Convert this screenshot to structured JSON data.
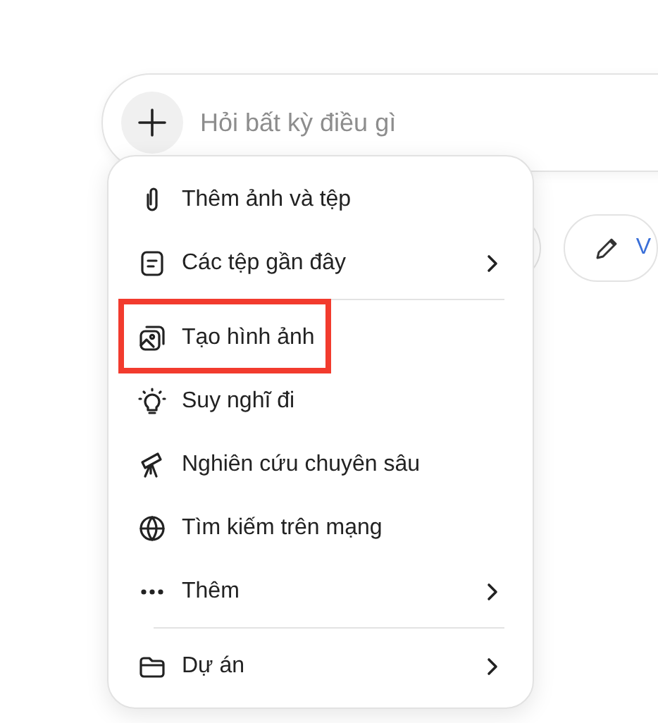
{
  "composer": {
    "placeholder": "Hỏi bất kỳ điều gì"
  },
  "chips": [
    {
      "label": "V"
    }
  ],
  "menu": {
    "sections": [
      [
        {
          "label": "Thêm ảnh và tệp",
          "submenu": false,
          "highlighted": false
        },
        {
          "label": "Các tệp gần đây",
          "submenu": true,
          "highlighted": false
        }
      ],
      [
        {
          "label": "Tạo hình ảnh",
          "submenu": false,
          "highlighted": true
        },
        {
          "label": "Suy nghĩ đi",
          "submenu": false,
          "highlighted": false
        },
        {
          "label": "Nghiên cứu chuyên sâu",
          "submenu": false,
          "highlighted": false
        },
        {
          "label": "Tìm kiếm trên mạng",
          "submenu": false,
          "highlighted": false
        },
        {
          "label": "Thêm",
          "submenu": true,
          "highlighted": false
        }
      ],
      [
        {
          "label": "Dự án",
          "submenu": true,
          "highlighted": false
        }
      ]
    ]
  }
}
